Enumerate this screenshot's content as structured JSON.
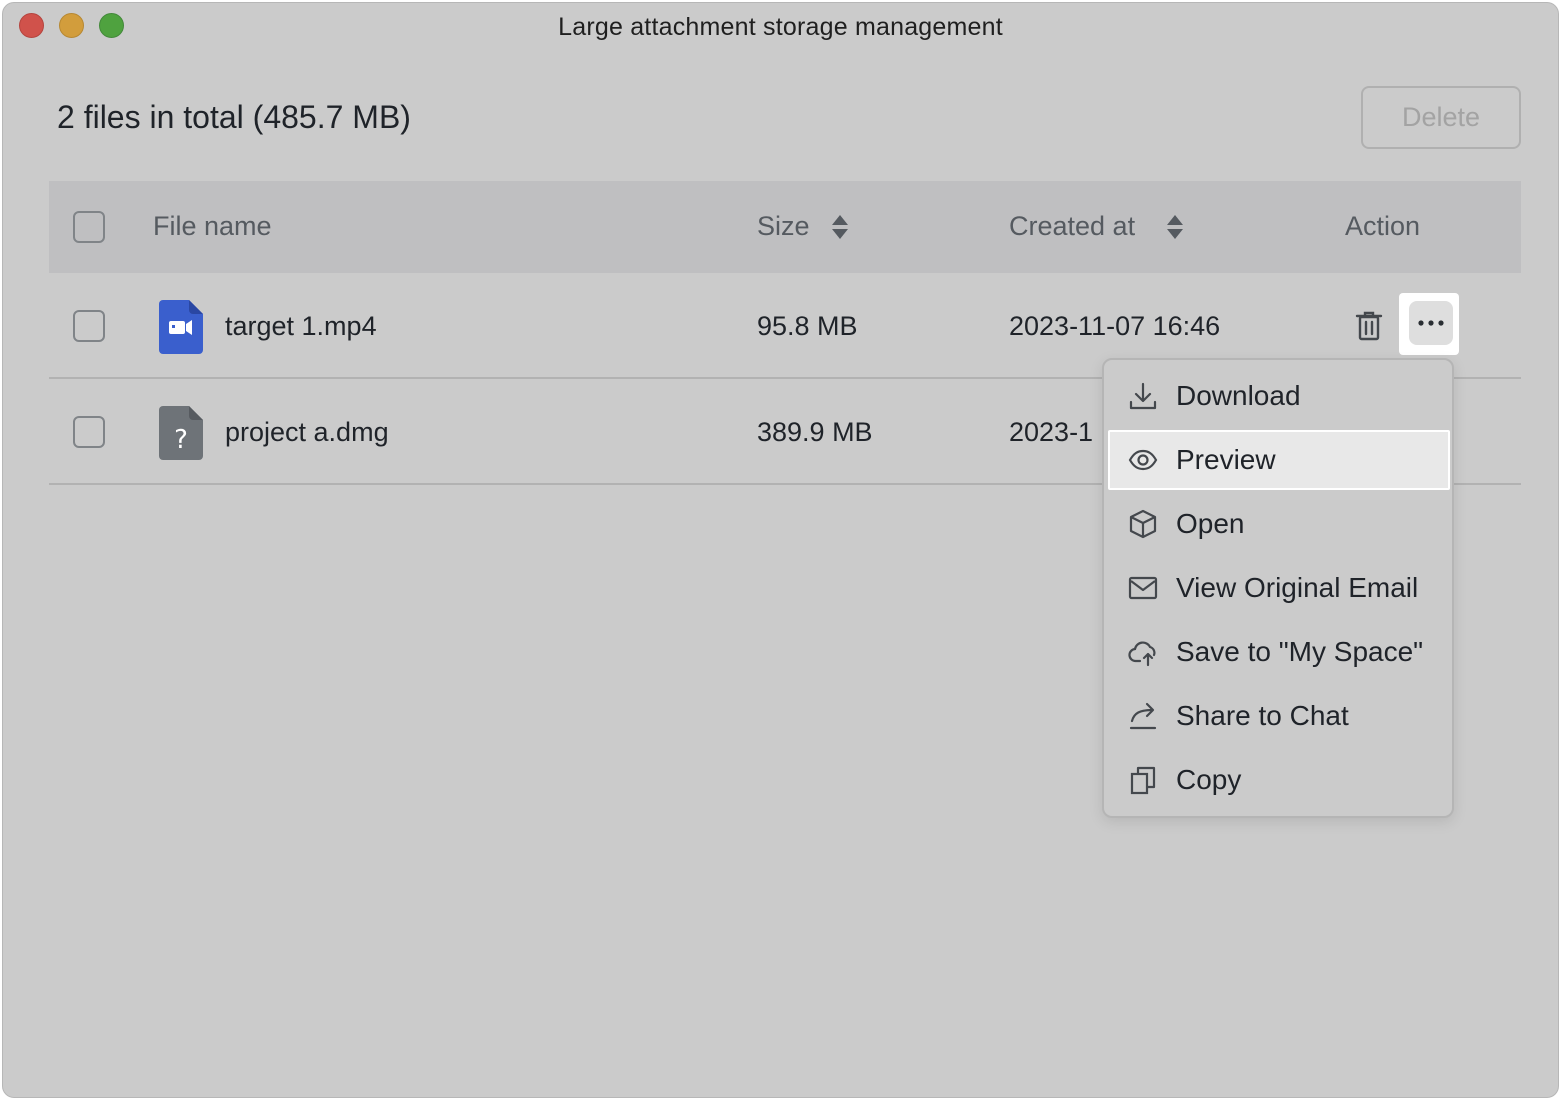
{
  "window": {
    "title": "Large attachment storage management"
  },
  "summary": {
    "text": "2 files in total (485.7 MB)"
  },
  "toolbar": {
    "delete_label": "Delete"
  },
  "table": {
    "headers": {
      "file_name": "File name",
      "size": "Size",
      "created_at": "Created at",
      "action": "Action"
    },
    "rows": [
      {
        "name": "target 1.mp4",
        "size": "95.8 MB",
        "created": "2023-11-07 16:46",
        "icon": "video-file-icon"
      },
      {
        "name": "project a.dmg",
        "size": "389.9 MB",
        "created": "2023-1",
        "icon": "unknown-file-icon"
      }
    ]
  },
  "context_menu": {
    "items": [
      {
        "label": "Download",
        "icon": "download-icon"
      },
      {
        "label": "Preview",
        "icon": "eye-icon",
        "highlighted": true
      },
      {
        "label": "Open",
        "icon": "cube-icon"
      },
      {
        "label": "View Original Email",
        "icon": "envelope-icon"
      },
      {
        "label": "Save to \"My Space\"",
        "icon": "cloud-upload-icon"
      },
      {
        "label": "Share to Chat",
        "icon": "share-icon"
      },
      {
        "label": "Copy",
        "icon": "copy-icon"
      }
    ]
  },
  "colors": {
    "background": "#cbcbcb",
    "header": "#bfbfc1",
    "video_icon": "#3a5fcd",
    "unknown_icon": "#6e7378",
    "highlight": "#e8e8e8"
  }
}
